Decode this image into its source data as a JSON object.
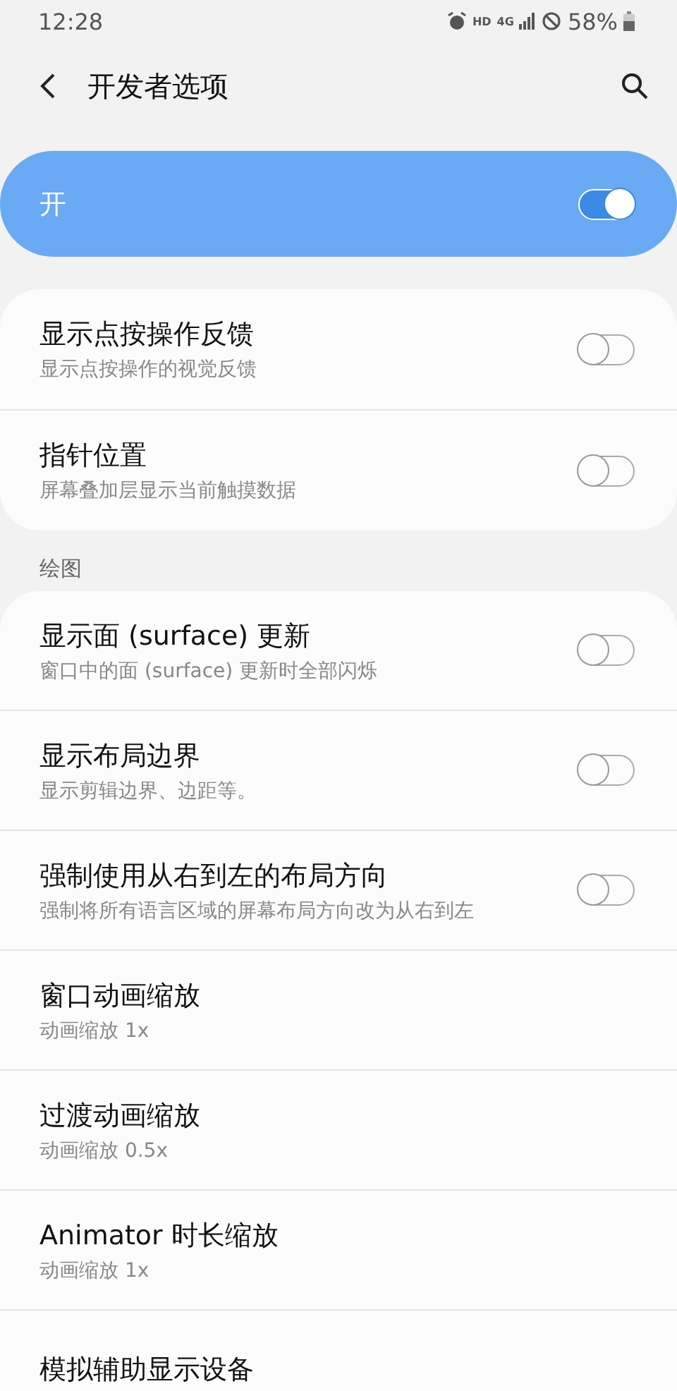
{
  "status_bar": {
    "time": "12:28",
    "network": "4G",
    "hd": "HD",
    "battery": "58%"
  },
  "header": {
    "title": "开发者选项"
  },
  "master": {
    "label": "开",
    "on": true
  },
  "sections": [
    {
      "items": [
        {
          "kind": "switch",
          "title": "显示点按操作反馈",
          "subtitle": "显示点按操作的视觉反馈",
          "on": false
        },
        {
          "kind": "switch",
          "title": "指针位置",
          "subtitle": "屏幕叠加层显示当前触摸数据",
          "on": false
        }
      ]
    },
    {
      "label": "绘图",
      "items": [
        {
          "kind": "switch",
          "title": "显示面 (surface) 更新",
          "subtitle": "窗口中的面 (surface) 更新时全部闪烁",
          "on": false
        },
        {
          "kind": "switch",
          "title": "显示布局边界",
          "subtitle": "显示剪辑边界、边距等。",
          "on": false
        },
        {
          "kind": "switch",
          "title": "强制使用从右到左的布局方向",
          "subtitle": "强制将所有语言区域的屏幕布局方向改为从右到左",
          "on": false
        },
        {
          "kind": "value",
          "title": "窗口动画缩放",
          "subtitle": "动画缩放 1x"
        },
        {
          "kind": "value",
          "title": "过渡动画缩放",
          "subtitle": "动画缩放 0.5x"
        },
        {
          "kind": "value",
          "title": "Animator 时长缩放",
          "subtitle": "动画缩放 1x"
        },
        {
          "kind": "value",
          "title": "模拟辅助显示设备"
        }
      ]
    }
  ]
}
